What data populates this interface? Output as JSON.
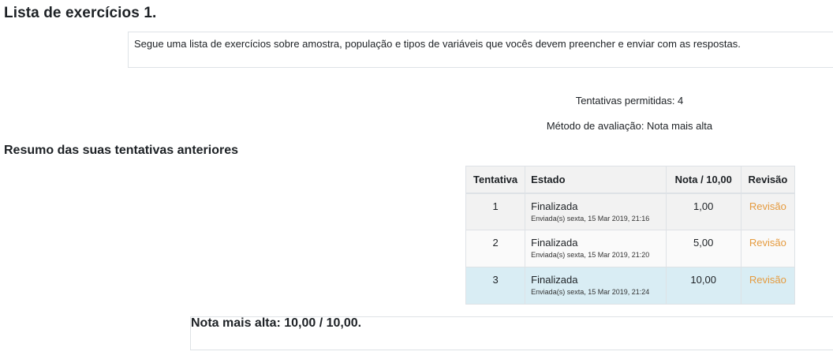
{
  "page": {
    "title": "Lista de exercícios 1.",
    "intro": "Segue uma lista de exercícios sobre amostra, população e tipos de variáveis que vocês devem preencher e enviar com as respostas."
  },
  "quiz_info": {
    "attempts_allowed": "Tentativas permitidas: 4",
    "grading_method": "Método de avaliação: Nota mais alta"
  },
  "summary": {
    "heading": "Resumo das suas tentativas anteriores",
    "columns": [
      "Tentativa",
      "Estado",
      "Nota / 10,00",
      "Revisão"
    ],
    "rows": [
      {
        "attempt": "1",
        "state": "Finalizada",
        "submitted": "Enviada(s) sexta, 15 Mar 2019, 21:16",
        "grade": "1,00",
        "review": "Revisão"
      },
      {
        "attempt": "2",
        "state": "Finalizada",
        "submitted": "Enviada(s) sexta, 15 Mar 2019, 21:20",
        "grade": "5,00",
        "review": "Revisão"
      },
      {
        "attempt": "3",
        "state": "Finalizada",
        "submitted": "Enviada(s) sexta, 15 Mar 2019, 21:24",
        "grade": "10,00",
        "review": "Revisão"
      }
    ]
  },
  "result": {
    "highest_grade": "Nota mais alta: 10,00 / 10,00."
  },
  "colors": {
    "link": "#e59b3f",
    "highlight_row": "#d9edf4"
  }
}
